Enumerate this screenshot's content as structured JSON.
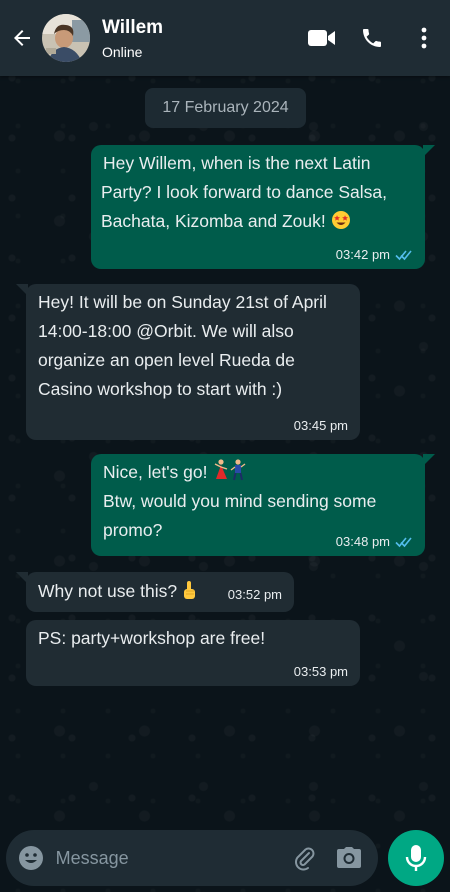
{
  "header": {
    "contact_name": "Willem",
    "status": "Online"
  },
  "chat": {
    "date_divider": "17 February 2024",
    "messages": [
      {
        "direction": "outgoing",
        "lines": [
          "Hey Willem, when is the next Latin",
          "Party? I look forward to dance Salsa,",
          "Bachata, Kizomba and Zouk!"
        ],
        "emoji": "star-struck",
        "time": "03:42 pm",
        "read": true
      },
      {
        "direction": "incoming",
        "lines": [
          "Hey! It will be on Sunday 21st of April",
          "14:00-18:00 @Orbit. We will also",
          "organize an open level Rueda de",
          "Casino workshop to start with :)"
        ],
        "time": "03:45 pm"
      },
      {
        "direction": "outgoing",
        "lines": [
          "Nice, let's go!",
          "Btw, would you mind sending some",
          "promo?"
        ],
        "emoji": "dancers",
        "time": "03:48 pm",
        "read": true
      },
      {
        "direction": "incoming",
        "lines": [
          "Why not use this?"
        ],
        "emoji": "pointing-up",
        "time": "03:52 pm"
      },
      {
        "direction": "incoming",
        "lines": [
          "PS: party+workshop are free!"
        ],
        "time": "03:53 pm"
      }
    ]
  },
  "composer": {
    "placeholder": "Message"
  },
  "colors": {
    "background": "#0b141a",
    "header": "#1f2c34",
    "outgoing_bubble": "#005c4b",
    "incoming_bubble": "#202c33",
    "accent": "#00a884",
    "read_ticks": "#53bdeb"
  },
  "icons": [
    "back-arrow-icon",
    "video-call-icon",
    "phone-icon",
    "more-vert-icon",
    "emoji-icon",
    "attach-icon",
    "camera-icon",
    "mic-icon",
    "double-check-icon"
  ]
}
